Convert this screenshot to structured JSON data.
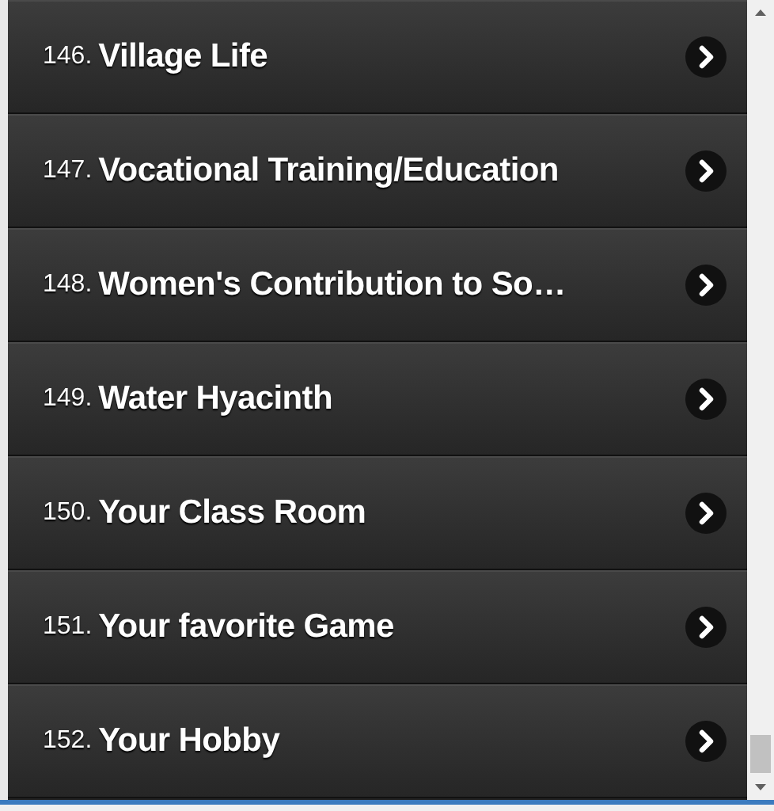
{
  "items": [
    {
      "number": "146.",
      "title": "Village Life"
    },
    {
      "number": "147.",
      "title": "Vocational Training/Education"
    },
    {
      "number": "148.",
      "title": "Women's Contribution to So…"
    },
    {
      "number": "149.",
      "title": "Water Hyacinth"
    },
    {
      "number": "150.",
      "title": "Your Class Room"
    },
    {
      "number": "151.",
      "title": "Your favorite Game"
    },
    {
      "number": "152.",
      "title": "Your Hobby"
    }
  ]
}
